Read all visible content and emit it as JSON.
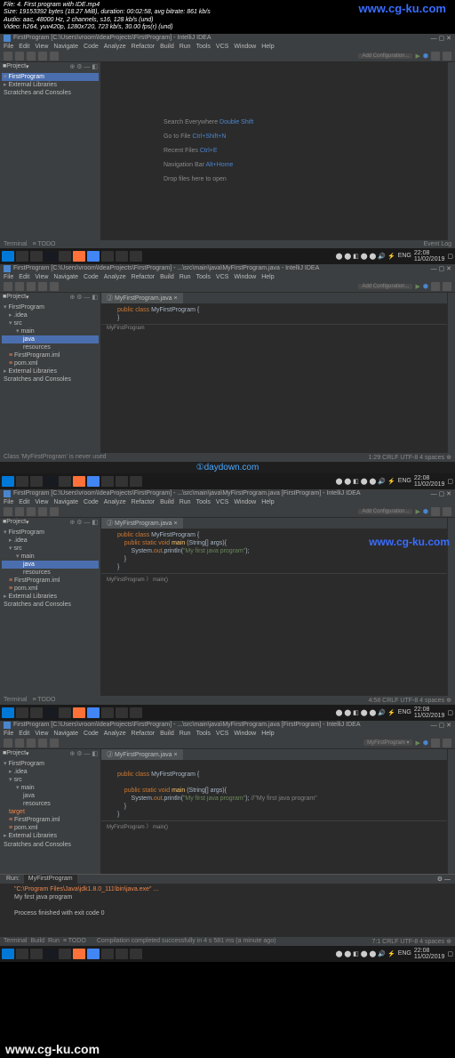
{
  "video_info": {
    "l1": "File: 4. First program with IDE.mp4",
    "l2": "Size: 19153392 bytes (18.27 MiB), duration: 00:02:58, avg bitrate: 861 kb/s",
    "l3": "Audio: aac, 48000 Hz, 2 channels, s16, 128 kb/s (und)",
    "l4": "Video: h264, yuv420p, 1280x720, 723 kb/s, 30.00 fps(r) (und)"
  },
  "watermarks": {
    "top": "www.cg-ku.com",
    "web": "www.cg-ku.com",
    "mid": "①daydown.com",
    "bot": "www.cg-ku.com"
  },
  "ide1": {
    "title": "FirstProgram [C:\\Users\\vroom\\IdeaProjects\\FirstProgram] - IntelliJ IDEA",
    "menu": [
      "File",
      "Edit",
      "View",
      "Navigate",
      "Code",
      "Analyze",
      "Refactor",
      "Build",
      "Run",
      "Tools",
      "VCS",
      "Window",
      "Help"
    ],
    "config": "Add Configuration...",
    "project_label": "Project",
    "tree": {
      "root": "FirstProgram",
      "lib": "External Libraries",
      "scratch": "Scratches and Consoles"
    },
    "welcome": {
      "r1": "Search Everywhere",
      "k1": "Double Shift",
      "r2": "Go to File",
      "k2": "Ctrl+Shift+N",
      "r3": "Recent Files",
      "k3": "Ctrl+E",
      "r4": "Navigation Bar",
      "k4": "Alt+Home",
      "r5": "Drop files here to open"
    },
    "status": {
      "terminal": "Terminal",
      "todo": "≡ TODO",
      "log": "Event Log"
    }
  },
  "ide2": {
    "title": "FirstProgram [C:\\Users\\vroom\\IdeaProjects\\FirstProgram] - ...\\src\\main\\java\\MyFirstProgram.java - IntelliJ IDEA",
    "tab": "MyFirstProgram.java",
    "code_l1": "public class MyFirstProgram {",
    "code_l2": "}",
    "tree": {
      "root": "FirstProgram",
      "idea": ".idea",
      "src": "src",
      "main": "main",
      "java": "java",
      "res": "resources",
      "fp": "FirstProgram.iml",
      "pom": "pom.xml",
      "lib": "External Libraries",
      "scratch": "Scratches and Consoles"
    },
    "crumb": "MyFirstProgram",
    "status_warn": "Class 'MyFirstProgram' is never used",
    "status_right": "1:29  CRLF  UTF-8  4 spaces  ⊕"
  },
  "ide3": {
    "title": "FirstProgram [C:\\Users\\vroom\\IdeaProjects\\FirstProgram] - ...\\src\\main\\java\\MyFirstProgram.java [FirstProgram] - IntelliJ IDEA",
    "tab": "MyFirstProgram.java",
    "code_l1": "public class MyFirstProgram {",
    "code_l2a": "    public static void main (String[] args){",
    "code_l2b": "        System.out.println(\"My first java program\");",
    "code_l3": "    }",
    "code_l4": "}",
    "tree": {
      "root": "FirstProgram",
      "idea": ".idea",
      "src": "src",
      "main": "main",
      "java": "java",
      "res": "resources",
      "fp": "FirstProgram.iml",
      "pom": "pom.xml",
      "lib": "External Libraries",
      "scratch": "Scratches and Consoles"
    },
    "crumb": "MyFirstProgram 〉 main()",
    "status_right": "4:58  CRLF  UTF-8  4 spaces  ⊕"
  },
  "ide4": {
    "title": "FirstProgram [C:\\Users\\vroom\\IdeaProjects\\FirstProgram] - ...\\src\\main\\java\\MyFirstProgram.java [FirstProgram] - IntelliJ IDEA",
    "tab": "MyFirstProgram.java",
    "tree": {
      "root": "FirstProgram",
      "idea": ".idea",
      "src": "src",
      "main": "main",
      "java": "java",
      "res": "resources",
      "tgt": "target",
      "fp": "FirstProgram.iml",
      "pom": "pom.xml",
      "lib": "External Libraries",
      "scratch": "Scratches and Consoles"
    },
    "console": {
      "tab1": "MyFirstProgram",
      "path": "\"C:\\Program Files\\Java\\jdk1.8.0_111\\bin\\java.exe\" ...",
      "out": "My first java program",
      "exit": "Process finished with exit code 0"
    },
    "crumb": "MyFirstProgram 〉 main()",
    "status": {
      "terminal": "Terminal",
      "build": "Build",
      "run": "Run",
      "todo": "≡ TODO",
      "msg": "Compilation completed successfully in 4 s 581 ms (a minute ago)"
    },
    "status_right": "7:1  CRLF  UTF-8  4 spaces  ⊕"
  },
  "taskbar": {
    "time": "22:08",
    "date": "11/02/2019",
    "lang": "ENG",
    "net": "lte"
  }
}
